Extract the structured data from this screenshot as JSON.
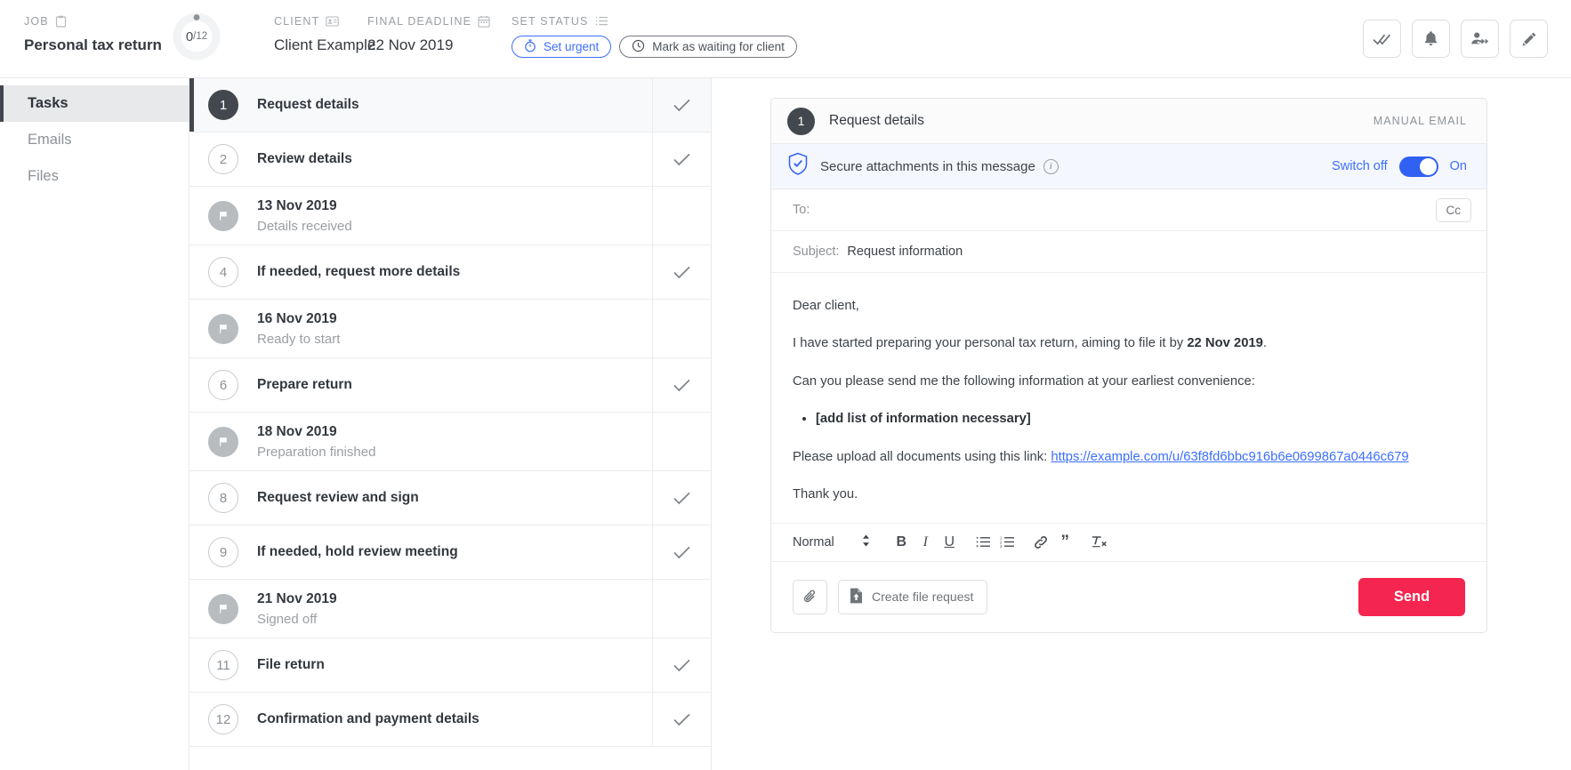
{
  "topbar": {
    "job": {
      "label": "JOB",
      "icon": "clipboard-icon",
      "value": "Personal tax return"
    },
    "progress": {
      "done": "0",
      "total": "/12"
    },
    "client": {
      "label": "CLIENT",
      "icon": "contact-card-icon",
      "value": "Client Example"
    },
    "deadline": {
      "label": "FINAL DEADLINE",
      "icon": "calendar-icon",
      "value": "22 Nov 2019"
    },
    "status": {
      "label": "SET STATUS",
      "icon": "list-icon",
      "urgent_label": "Set urgent",
      "urgent_icon": "stopwatch-icon",
      "waiting_label": "Mark as waiting for client",
      "waiting_icon": "clock-icon"
    },
    "actions": [
      {
        "name": "mark-all-done-button",
        "icon": "double-check-icon"
      },
      {
        "name": "notifications-button",
        "icon": "bell-icon"
      },
      {
        "name": "assign-user-button",
        "icon": "person-arrow-icon"
      },
      {
        "name": "edit-button",
        "icon": "pencil-icon"
      }
    ],
    "accent_blue": "#3b6fff",
    "accent_red": "#f4254f"
  },
  "sidebar": {
    "items": [
      {
        "label": "Tasks",
        "active": true
      },
      {
        "label": "Emails",
        "active": false
      },
      {
        "label": "Files",
        "active": false
      }
    ]
  },
  "tasks": [
    {
      "kind": "task",
      "num": "1",
      "title": "Request details",
      "sub": "",
      "active": true,
      "check": true
    },
    {
      "kind": "task",
      "num": "2",
      "title": "Review details",
      "sub": "",
      "active": false,
      "check": true
    },
    {
      "kind": "milestone",
      "num": "",
      "title": "13 Nov 2019",
      "sub": "Details received",
      "active": false,
      "check": false
    },
    {
      "kind": "task",
      "num": "4",
      "title": "If needed, request more details",
      "sub": "",
      "active": false,
      "check": true
    },
    {
      "kind": "milestone",
      "num": "",
      "title": "16 Nov 2019",
      "sub": "Ready to start",
      "active": false,
      "check": false
    },
    {
      "kind": "task",
      "num": "6",
      "title": "Prepare return",
      "sub": "",
      "active": false,
      "check": true
    },
    {
      "kind": "milestone",
      "num": "",
      "title": "18 Nov 2019",
      "sub": "Preparation finished",
      "active": false,
      "check": false
    },
    {
      "kind": "task",
      "num": "8",
      "title": "Request review and sign",
      "sub": "",
      "active": false,
      "check": true
    },
    {
      "kind": "task",
      "num": "9",
      "title": "If needed, hold review meeting",
      "sub": "",
      "active": false,
      "check": true
    },
    {
      "kind": "milestone",
      "num": "",
      "title": "21 Nov 2019",
      "sub": "Signed off",
      "active": false,
      "check": false
    },
    {
      "kind": "task",
      "num": "11",
      "title": "File return",
      "sub": "",
      "active": false,
      "check": true
    },
    {
      "kind": "task",
      "num": "12",
      "title": "Confirmation and payment details",
      "sub": "",
      "active": false,
      "check": true
    }
  ],
  "composer": {
    "step_num": "1",
    "title": "Request details",
    "kind": "MANUAL EMAIL",
    "secure": {
      "icon": "shield-check-icon",
      "text": "Secure attachments in this message",
      "info_icon": "info-icon",
      "switch_off_label": "Switch off",
      "toggle_state_label": "On",
      "toggle_on": true
    },
    "to": {
      "label": "To:",
      "value": "",
      "placeholder": ""
    },
    "cc": {
      "label": "Cc"
    },
    "subject": {
      "label": "Subject:",
      "value": "Request information"
    },
    "message": {
      "greeting": "Dear client,",
      "line1_pre": "I have started preparing your personal tax return, aiming to file it by ",
      "line1_bold": "22 Nov 2019",
      "line1_post": ".",
      "line2": "Can you please send me the following information at your earliest convenience:",
      "bullets": [
        "[add list of information necessary]"
      ],
      "line3_pre": "Please upload all documents using this link: ",
      "link_text": "https://example.com/u/63f8fd6bbc916b6e0699867a0446c679",
      "closing": "Thank you."
    },
    "toolbar": {
      "style_label": "Normal",
      "buttons": [
        {
          "name": "bold-icon",
          "glyph": "B"
        },
        {
          "name": "italic-icon",
          "glyph": "I"
        },
        {
          "name": "underline-icon",
          "glyph": "U"
        },
        {
          "name": "bullet-list-icon",
          "glyph": ""
        },
        {
          "name": "numbered-list-icon",
          "glyph": ""
        },
        {
          "name": "link-icon",
          "glyph": ""
        },
        {
          "name": "blockquote-icon",
          "glyph": ""
        },
        {
          "name": "clear-format-icon",
          "glyph": ""
        }
      ]
    },
    "footer": {
      "attach_icon": "paperclip-icon",
      "file_request_label": "Create file request",
      "file_request_icon": "file-upload-icon",
      "send_label": "Send"
    }
  }
}
